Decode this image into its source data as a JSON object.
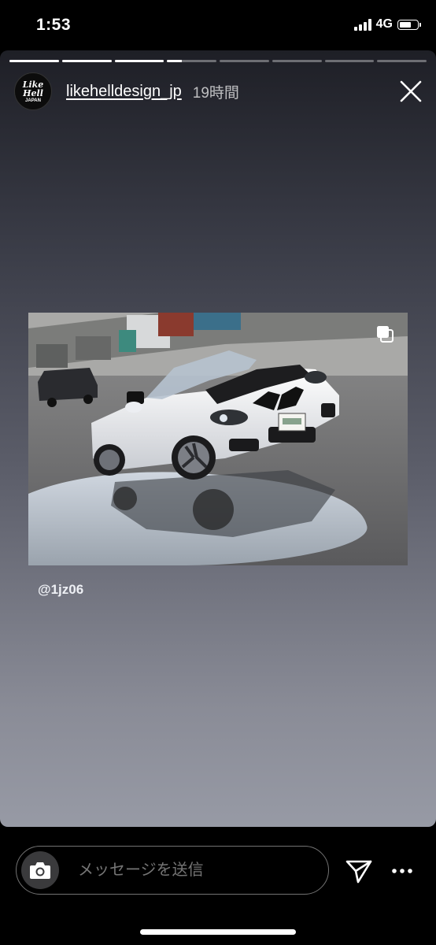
{
  "status_bar": {
    "time": "1:53",
    "network": "4G",
    "battery_level": 0.75,
    "signal_bars": 4
  },
  "story": {
    "progress": {
      "segments_total": 8,
      "segments_completed": 3,
      "current_segment_progress": 0.3
    },
    "account": {
      "username": "likehelldesign_jp",
      "posted_ago": "19時間",
      "avatar_text_top": "Like Hell",
      "avatar_text_bottom": "JAPAN"
    },
    "mention": "@1jz06",
    "multi_photo_icon": "stacked-squares-icon",
    "gradient_colors": [
      "#1e1f26",
      "#3a3c47",
      "#5d5f6b",
      "#8a8c97",
      "#979aa5"
    ]
  },
  "reply_bar": {
    "placeholder": "メッセージを送信",
    "camera_icon": "camera-icon",
    "send_icon": "paper-plane-icon",
    "more_icon": "more-dots-icon"
  }
}
